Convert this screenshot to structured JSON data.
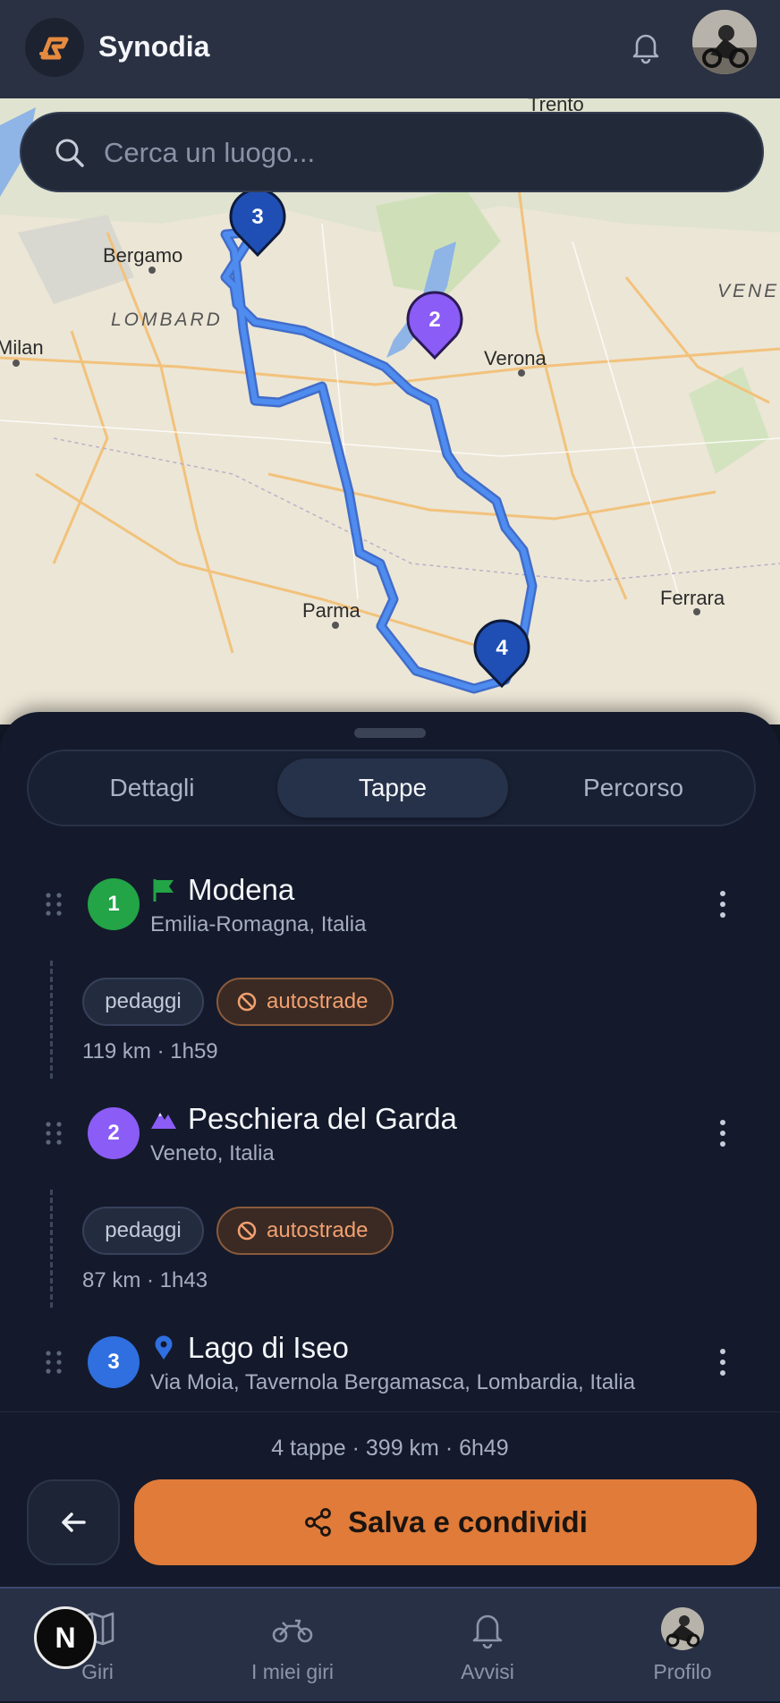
{
  "app": {
    "name": "Synodia"
  },
  "header": {
    "notifications_icon": "bell-icon",
    "avatar": "profile-avatar"
  },
  "search": {
    "placeholder": "Cerca un luogo..."
  },
  "map": {
    "labels": {
      "trento": "Trento",
      "bergamo": "Bergamo",
      "lombard": "LOMBARD",
      "milan": "Milan",
      "verona": "Verona",
      "vene": "VENE",
      "parma": "Parma",
      "ferrara": "Ferrara"
    },
    "markers": [
      "3",
      "2",
      "4"
    ],
    "route_color": "#3d7ae0"
  },
  "tabs": [
    {
      "label": "Dettagli"
    },
    {
      "label": "Tappe"
    },
    {
      "label": "Percorso"
    }
  ],
  "active_tab": "Tappe",
  "stops": [
    {
      "num": "1",
      "name": "Modena",
      "sub": "Emilia-Romagna, Italia",
      "icon": "flag-icon",
      "color": "#22a447"
    },
    {
      "num": "2",
      "name": "Peschiera del Garda",
      "sub": "Veneto, Italia",
      "icon": "mountain-icon",
      "color": "#8b5cf6"
    },
    {
      "num": "3",
      "name": "Lago di Iseo",
      "sub": "Via Moia, Tavernola Bergamasca, Lombardia, Italia",
      "icon": "pin-icon",
      "color": "#2f6fe0"
    }
  ],
  "legs": [
    {
      "toll": "pedaggi",
      "highway": "autostrade",
      "meta": "119 km · 1h59"
    },
    {
      "toll": "pedaggi",
      "highway": "autostrade",
      "meta": "87 km · 1h43"
    }
  ],
  "footer": {
    "summary": "4 tappe · 399 km · 6h49",
    "save_label": "Salva e condividi"
  },
  "nav": [
    {
      "label": "Giri"
    },
    {
      "label": "I miei giri"
    },
    {
      "label": "Avvisi"
    },
    {
      "label": "Profilo"
    }
  ],
  "badge": {
    "letter": "N"
  },
  "colors": {
    "accent": "#e07b39",
    "background": "#141a2b"
  }
}
